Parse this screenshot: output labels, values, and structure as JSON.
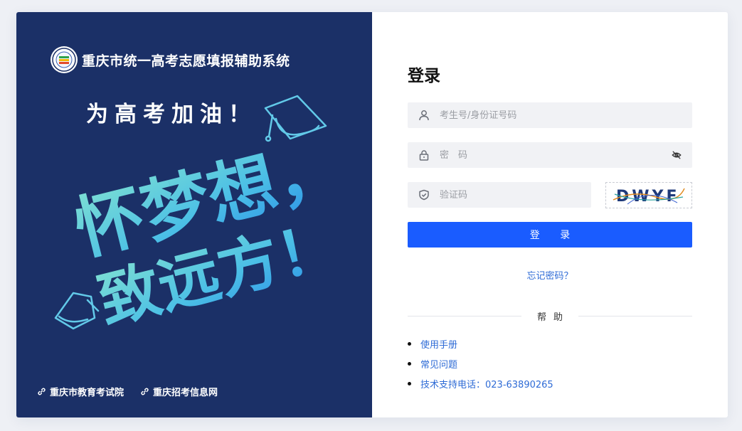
{
  "left_panel": {
    "system_title": "重庆市统一高考志愿填报辅助系统",
    "slogan": "为高考加油！",
    "art_line1": "怀梦想，",
    "art_line2": "致远方！",
    "links": [
      {
        "label": "重庆市教育考试院"
      },
      {
        "label": "重庆招考信息网"
      }
    ]
  },
  "login": {
    "title": "登录",
    "username_placeholder": "考生号/身份证号码",
    "password_placeholder": "密　码",
    "captcha_placeholder": "验证码",
    "captcha_text": "DWYF",
    "submit_label": "登 录",
    "forgot_label": "忘记密码？"
  },
  "help": {
    "title": "帮助",
    "items": [
      {
        "label": "使用手册"
      },
      {
        "label": "常见问题"
      },
      {
        "label": "技术支持电话：023-63890265"
      }
    ]
  },
  "colors": {
    "left_bg": "#1b3067",
    "primary": "#1a5cff",
    "link": "#2e6bd6",
    "field_bg": "#f1f2f5"
  }
}
